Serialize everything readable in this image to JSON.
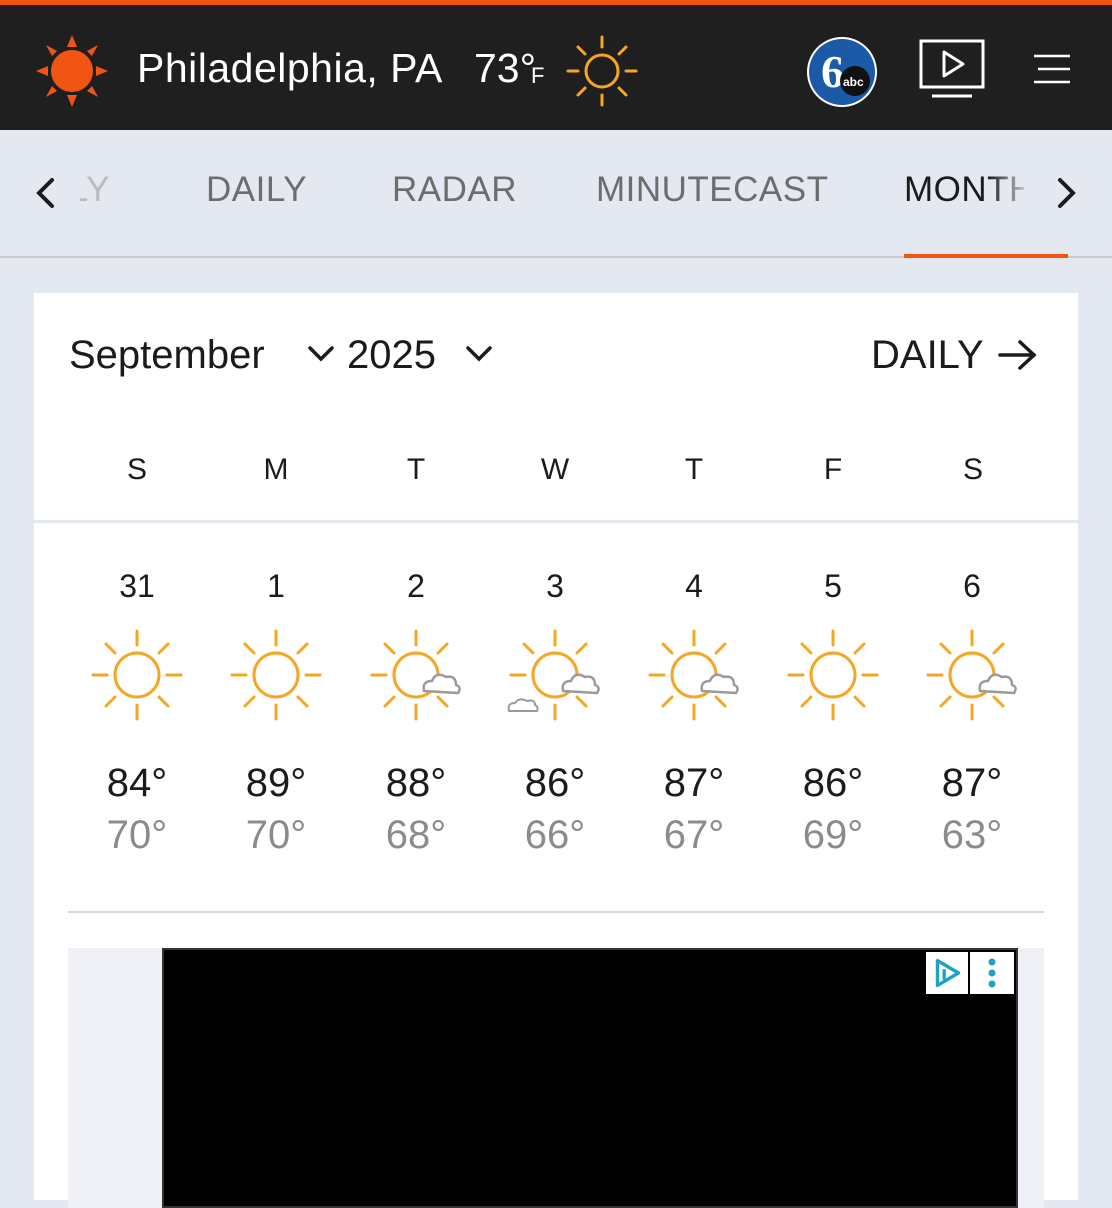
{
  "header": {
    "city": "Philadelphia, PA",
    "current_temp": "73°",
    "unit": "F",
    "current_icon": "sun-icon",
    "brand_color": "#f05514"
  },
  "tabs": {
    "partial_left": "LY",
    "items": [
      "DAILY",
      "RADAR",
      "MINUTECAST",
      "MONTHLY"
    ],
    "active": "MONTHLY"
  },
  "calendar": {
    "month": "September",
    "year": "2025",
    "daily_link": "DAILY",
    "weekdays": [
      "S",
      "M",
      "T",
      "W",
      "T",
      "F",
      "S"
    ],
    "days": [
      {
        "date": "31",
        "icon": "sunny",
        "hi": "84°",
        "lo": "70°"
      },
      {
        "date": "1",
        "icon": "sunny",
        "hi": "89°",
        "lo": "70°"
      },
      {
        "date": "2",
        "icon": "partly-sunny",
        "hi": "88°",
        "lo": "68°"
      },
      {
        "date": "3",
        "icon": "partly-cloudy",
        "hi": "86°",
        "lo": "66°"
      },
      {
        "date": "4",
        "icon": "partly-sunny",
        "hi": "87°",
        "lo": "67°"
      },
      {
        "date": "5",
        "icon": "sunny",
        "hi": "86°",
        "lo": "69°"
      },
      {
        "date": "6",
        "icon": "partly-sunny",
        "hi": "87°",
        "lo": "63°"
      }
    ]
  },
  "ad": {
    "badge_icons": [
      "play-icon",
      "more-icon"
    ]
  }
}
